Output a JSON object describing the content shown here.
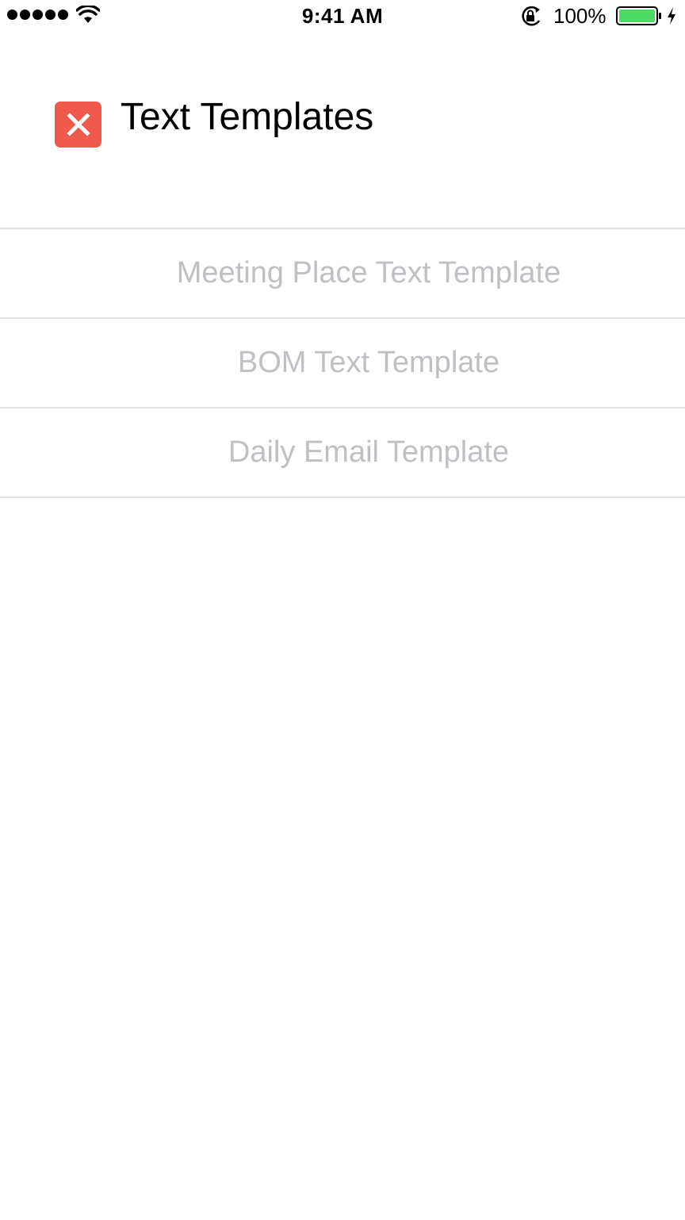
{
  "status_bar": {
    "time": "9:41 AM",
    "battery_percent": "100%",
    "battery_level": 1.0,
    "signal_bars": 5,
    "icons": [
      "signal-dots",
      "wifi-icon",
      "rotation-lock-icon",
      "battery-icon",
      "charging-icon"
    ],
    "battery_color": "#4cd964"
  },
  "header": {
    "title": "Text Templates",
    "close_icon": "close-icon",
    "close_color": "#f05a4c"
  },
  "templates": [
    {
      "label": "Meeting Place Text Template"
    },
    {
      "label": "BOM Text Template"
    },
    {
      "label": "Daily Email Template"
    }
  ],
  "colors": {
    "item_text": "#bfbfc4",
    "separator": "#e2e2e6"
  }
}
